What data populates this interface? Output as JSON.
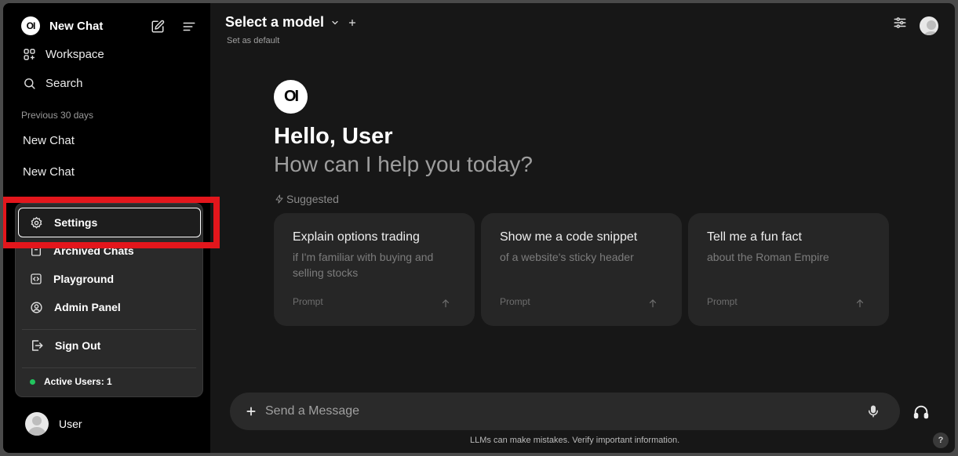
{
  "sidebar": {
    "logo_text": "OI",
    "title": "New Chat",
    "workspace_label": "Workspace",
    "search_label": "Search",
    "section_label": "Previous 30 days",
    "chats": [
      "New Chat",
      "New Chat"
    ],
    "user_name": "User"
  },
  "menu": {
    "settings": "Settings",
    "archived": "Archived Chats",
    "playground": "Playground",
    "admin": "Admin Panel",
    "signout": "Sign Out",
    "active_users": "Active Users: 1"
  },
  "header": {
    "model_select": "Select a model",
    "set_default": "Set as default"
  },
  "main": {
    "logo_text": "OI",
    "greeting": "Hello, User",
    "subtitle": "How can I help you today?",
    "suggested_label": "Suggested",
    "cards": [
      {
        "title": "Explain options trading",
        "sub": "if I'm familiar with buying and selling stocks",
        "tag": "Prompt"
      },
      {
        "title": "Show me a code snippet",
        "sub": "of a website's sticky header",
        "tag": "Prompt"
      },
      {
        "title": "Tell me a fun fact",
        "sub": "about the Roman Empire",
        "tag": "Prompt"
      }
    ]
  },
  "input": {
    "placeholder": "Send a Message"
  },
  "footer": {
    "disclaimer": "LLMs can make mistakes. Verify important information.",
    "help": "?"
  },
  "colors": {
    "highlight": "#e3161c",
    "active_dot": "#22c55e",
    "background": "#171717",
    "sidebar": "#000000"
  }
}
